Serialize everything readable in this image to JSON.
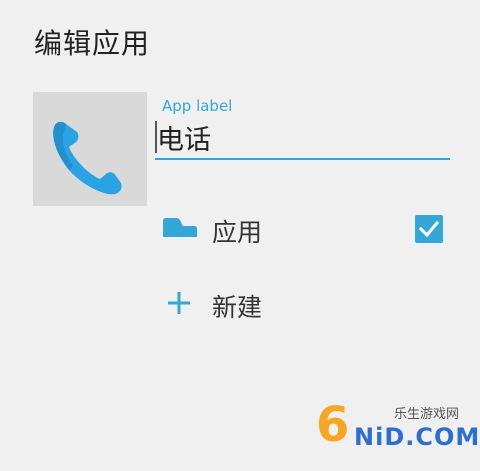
{
  "dialog": {
    "title": "编辑应用"
  },
  "app": {
    "icon": "phone-icon",
    "name_label": "App label",
    "name_value": "电话"
  },
  "category_row": {
    "icon": "shelf-icon",
    "label": "应用",
    "checked": true
  },
  "new_row": {
    "icon": "plus-icon",
    "label": "新建"
  },
  "watermark": {
    "site_name": "乐生游戏网",
    "logo_text": "NiD.COM",
    "logo_digit": "6"
  },
  "colors": {
    "accent": "#33a8d8",
    "background": "#f0f0f0",
    "icon_tile": "#d9d9d9",
    "phone_icon": "#29a3e3"
  }
}
